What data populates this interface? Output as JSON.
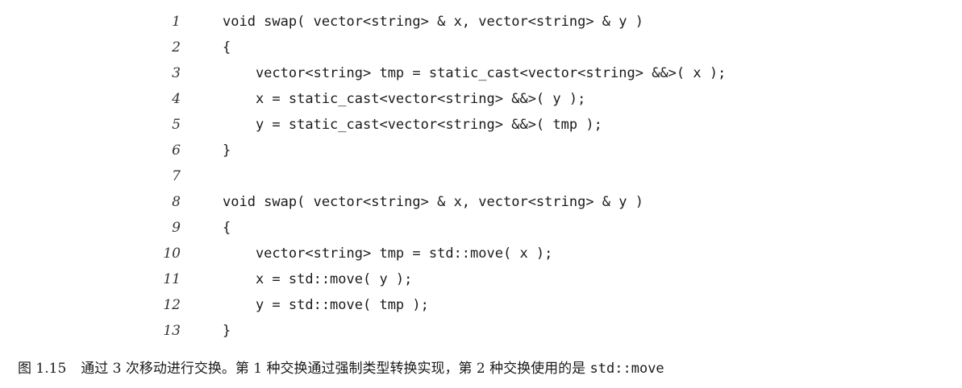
{
  "code": {
    "lines": [
      {
        "num": "1",
        "text": "void swap( vector<string> & x, vector<string> & y )"
      },
      {
        "num": "2",
        "text": "{"
      },
      {
        "num": "3",
        "text": "    vector<string> tmp = static_cast<vector<string> &&>( x );"
      },
      {
        "num": "4",
        "text": "    x = static_cast<vector<string> &&>( y );"
      },
      {
        "num": "5",
        "text": "    y = static_cast<vector<string> &&>( tmp );"
      },
      {
        "num": "6",
        "text": "}"
      },
      {
        "num": "7",
        "text": ""
      },
      {
        "num": "8",
        "text": "void swap( vector<string> & x, vector<string> & y )"
      },
      {
        "num": "9",
        "text": "{"
      },
      {
        "num": "10",
        "text": "    vector<string> tmp = std::move( x );"
      },
      {
        "num": "11",
        "text": "    x = std::move( y );"
      },
      {
        "num": "12",
        "text": "    y = std::move( tmp );"
      },
      {
        "num": "13",
        "text": "}"
      }
    ]
  },
  "caption": {
    "label": "图 1.15",
    "text": "通过 3 次移动进行交换。第 1 种交换通过强制类型转换实现，第 2 种交换使用的是",
    "code": "std::move"
  }
}
